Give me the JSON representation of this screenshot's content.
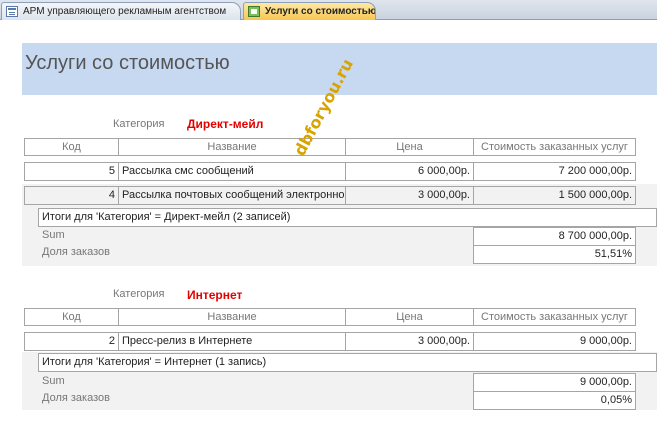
{
  "tabs": [
    {
      "label": "АРМ управляющего рекламным агентством",
      "active": false,
      "icon": "form-icon"
    },
    {
      "label": "Услуги со стоимостью",
      "active": true,
      "icon": "report-icon"
    }
  ],
  "report": {
    "title": "Услуги со стоимостью",
    "columns": {
      "code": "Код",
      "name": "Название",
      "price": "Цена",
      "total": "Стоимость заказанных услуг"
    },
    "category_label": "Категория",
    "groups": [
      {
        "category": "Директ-мейл",
        "rows": [
          {
            "code": "5",
            "name": "Рассылка смс сообщений",
            "price": "6 000,00р.",
            "total": "7 200 000,00р."
          },
          {
            "code": "4",
            "name": "Рассылка почтовых сообщений электронно",
            "price": "3 000,00р.",
            "total": "1 500 000,00р."
          }
        ],
        "summary_text": "Итоги для 'Категория' =  Директ-мейл (2 записей)",
        "sum_label": "Sum",
        "sum_value": "8 700 000,00р.",
        "share_label": "Доля заказов",
        "share_value": "51,51%"
      },
      {
        "category": "Интернет",
        "rows": [
          {
            "code": "2",
            "name": "Пресс-релиз в Интернете",
            "price": "3 000,00р.",
            "total": "9 000,00р."
          }
        ],
        "summary_text": "Итоги для 'Категория' =  Интернет (1 запись)",
        "sum_label": "Sum",
        "sum_value": "9 000,00р.",
        "share_label": "Доля заказов",
        "share_value": "0,05%"
      }
    ]
  },
  "watermark": "dbforyou.ru",
  "colors": {
    "header_bg": "#c6d9f1",
    "category_value": "#e30000",
    "active_tab": "#f7c652"
  }
}
